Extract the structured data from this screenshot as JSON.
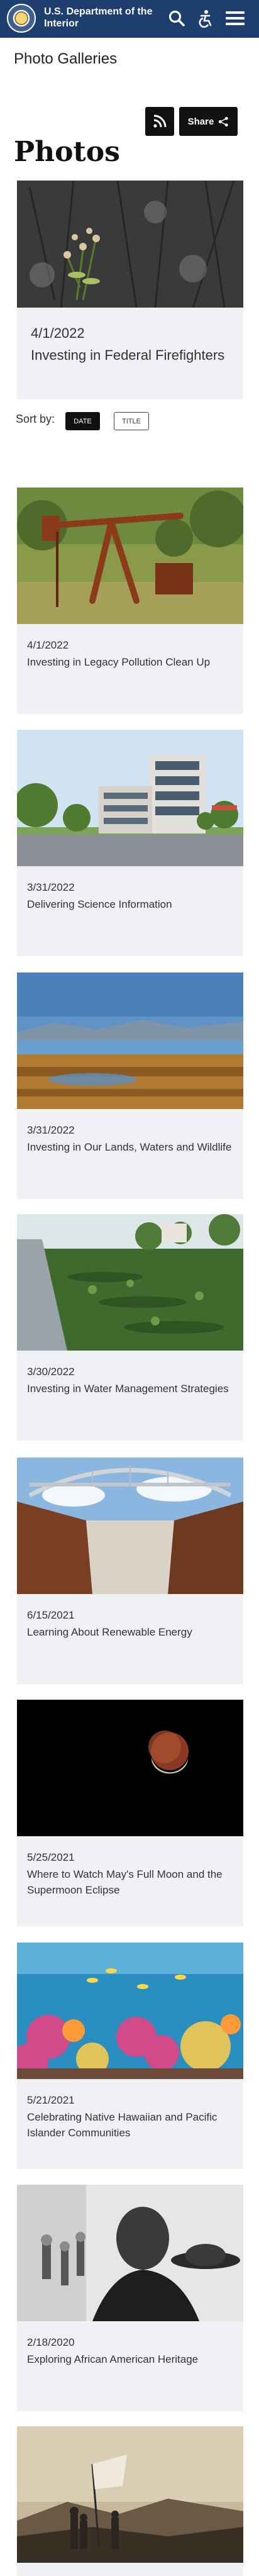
{
  "header": {
    "agency_line1": "U.S. Department of the",
    "agency_line2": "Interior",
    "icons": [
      "search-icon",
      "accessibility-icon",
      "menu-icon"
    ],
    "color": "#1d3e6f"
  },
  "section_title": "Photo Galleries",
  "actions": {
    "share_label": "Share"
  },
  "page_heading": "Photos",
  "featured": {
    "date": "4/1/2022",
    "title": "Investing in Federal Firefighters"
  },
  "sort": {
    "label": "Sort by:",
    "options": [
      "DATE",
      "TITLE"
    ],
    "selected": "DATE"
  },
  "galleries": [
    {
      "date": "4/1/2022",
      "title": "Investing in Legacy Pollution Clean Up"
    },
    {
      "date": "3/31/2022",
      "title": "Delivering Science Information"
    },
    {
      "date": "3/31/2022",
      "title": "Investing in Our Lands, Waters and Wildlife"
    },
    {
      "date": "3/30/2022",
      "title": "Investing in Water Management Strategies"
    },
    {
      "date": "6/15/2021",
      "title": "Learning About Renewable Energy"
    },
    {
      "date": "5/25/2021",
      "title": "Where to Watch May's Full Moon and the Supermoon Eclipse"
    },
    {
      "date": "5/21/2021",
      "title": "Celebrating Native Hawaiian and Pacific Islander Communities"
    },
    {
      "date": "2/18/2020",
      "title": "Exploring African American Heritage"
    }
  ]
}
